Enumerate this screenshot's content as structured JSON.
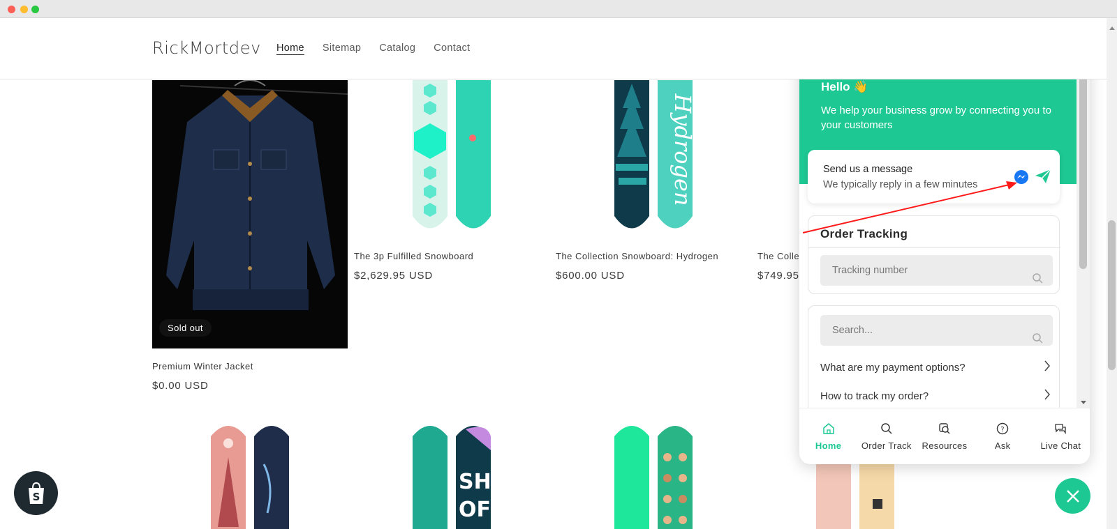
{
  "store": {
    "brand": "RickMortdev",
    "nav": [
      "Home",
      "Sitemap",
      "Catalog",
      "Contact"
    ]
  },
  "products": [
    {
      "title": "Premium Winter Jacket",
      "price": "$0.00 USD",
      "badge": "Sold out"
    },
    {
      "title": "The 3p Fulfilled Snowboard",
      "price": "$2,629.95 USD"
    },
    {
      "title": "The Collection Snowboard: Hydrogen",
      "price": "$600.00 USD"
    },
    {
      "title": "The Collec",
      "price": "$749.95"
    }
  ],
  "widget": {
    "hello": "Hello 👋",
    "subtitle": "We help your business grow by connecting you to your customers",
    "message_title": "Send us a message",
    "message_sub": "We typically reply in a few minutes",
    "order_tracking_title": "Order Tracking",
    "tracking_placeholder": "Tracking number",
    "search_placeholder": "Search...",
    "faq": [
      "What are my payment options?",
      "How to track my order?"
    ],
    "tabs": [
      "Home",
      "Order Track",
      "Resources",
      "Ask",
      "Live Chat"
    ],
    "accent_color": "#1ec893"
  }
}
